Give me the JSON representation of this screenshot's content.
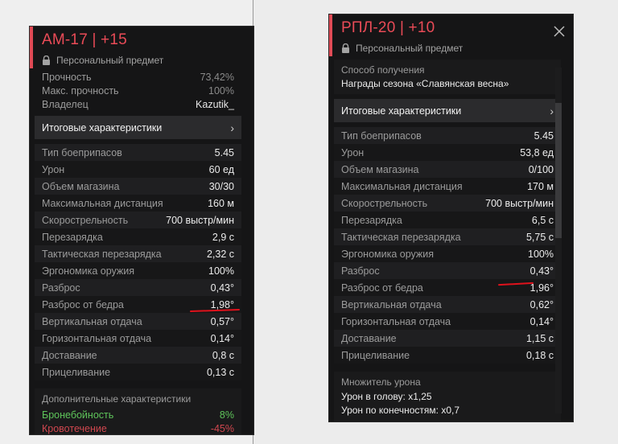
{
  "left": {
    "title": "АМ-17 | +15",
    "subtitle": "Персональный предмет",
    "info": [
      {
        "k": "Прочность",
        "v": "73,42%"
      },
      {
        "k": "Макс. прочность",
        "v": "100%"
      },
      {
        "k": "Владелец",
        "v": "Kazutik_"
      }
    ],
    "section_label": "Итоговые характеристики",
    "stats": [
      {
        "k": "Тип боеприпасов",
        "v": "5.45"
      },
      {
        "k": "Урон",
        "v": "60 ед"
      },
      {
        "k": "Объем магазина",
        "v": "30/30"
      },
      {
        "k": "Максимальная дистанция",
        "v": "160 м"
      },
      {
        "k": "Скорострельность",
        "v": "700 выстр/мин"
      },
      {
        "k": "Перезарядка",
        "v": "2,9 с"
      },
      {
        "k": "Тактическая перезарядка",
        "v": "2,32 с"
      },
      {
        "k": "Эргономика оружия",
        "v": "100%"
      },
      {
        "k": "Разброс",
        "v": "0,43°"
      },
      {
        "k": "Разброс от бедра",
        "v": "1,98°"
      },
      {
        "k": "Вертикальная отдача",
        "v": "0,57°"
      },
      {
        "k": "Горизонтальная отдача",
        "v": "0,14°"
      },
      {
        "k": "Доставание",
        "v": "0,8 с"
      },
      {
        "k": "Прицеливание",
        "v": "0,13 с"
      }
    ],
    "extra_caption": "Дополнительные характеристики",
    "extra": [
      {
        "k": "Бронебойность",
        "v": "8%"
      },
      {
        "k": "Кровотечение",
        "v": "-45%"
      }
    ]
  },
  "right": {
    "title": "РПЛ-20 | +10",
    "subtitle": "Персональный предмет",
    "obtain_caption": "Способ получения",
    "obtain_value": "Награды сезона «Славянская весна»",
    "section_label": "Итоговые характеристики",
    "stats": [
      {
        "k": "Тип боеприпасов",
        "v": "5.45"
      },
      {
        "k": "Урон",
        "v": "53,8 ед"
      },
      {
        "k": "Объем магазина",
        "v": "0/100"
      },
      {
        "k": "Максимальная дистанция",
        "v": "170 м"
      },
      {
        "k": "Скорострельность",
        "v": "700 выстр/мин"
      },
      {
        "k": "Перезарядка",
        "v": "6,5 с"
      },
      {
        "k": "Тактическая перезарядка",
        "v": "5,75 с"
      },
      {
        "k": "Эргономика оружия",
        "v": "100%"
      },
      {
        "k": "Разброс",
        "v": "0,43°"
      },
      {
        "k": "Разброс от бедра",
        "v": "1,96°"
      },
      {
        "k": "Вертикальная отдача",
        "v": "0,62°"
      },
      {
        "k": "Горизонтальная отдача",
        "v": "0,14°"
      },
      {
        "k": "Доставание",
        "v": "1,15 с"
      },
      {
        "k": "Прицеливание",
        "v": "0,18 с"
      }
    ],
    "mult_caption": "Множитель урона",
    "mult": [
      "Урон в голову: x1,25",
      "Урон по конечностям: x0,7"
    ]
  },
  "colors": {
    "accent": "#ea4b57",
    "annotation": "#e0121c",
    "positive": "#5ec45a",
    "negative": "#d0474f"
  },
  "icons": [
    "lock-icon",
    "close-icon",
    "chevron-right-icon"
  ]
}
